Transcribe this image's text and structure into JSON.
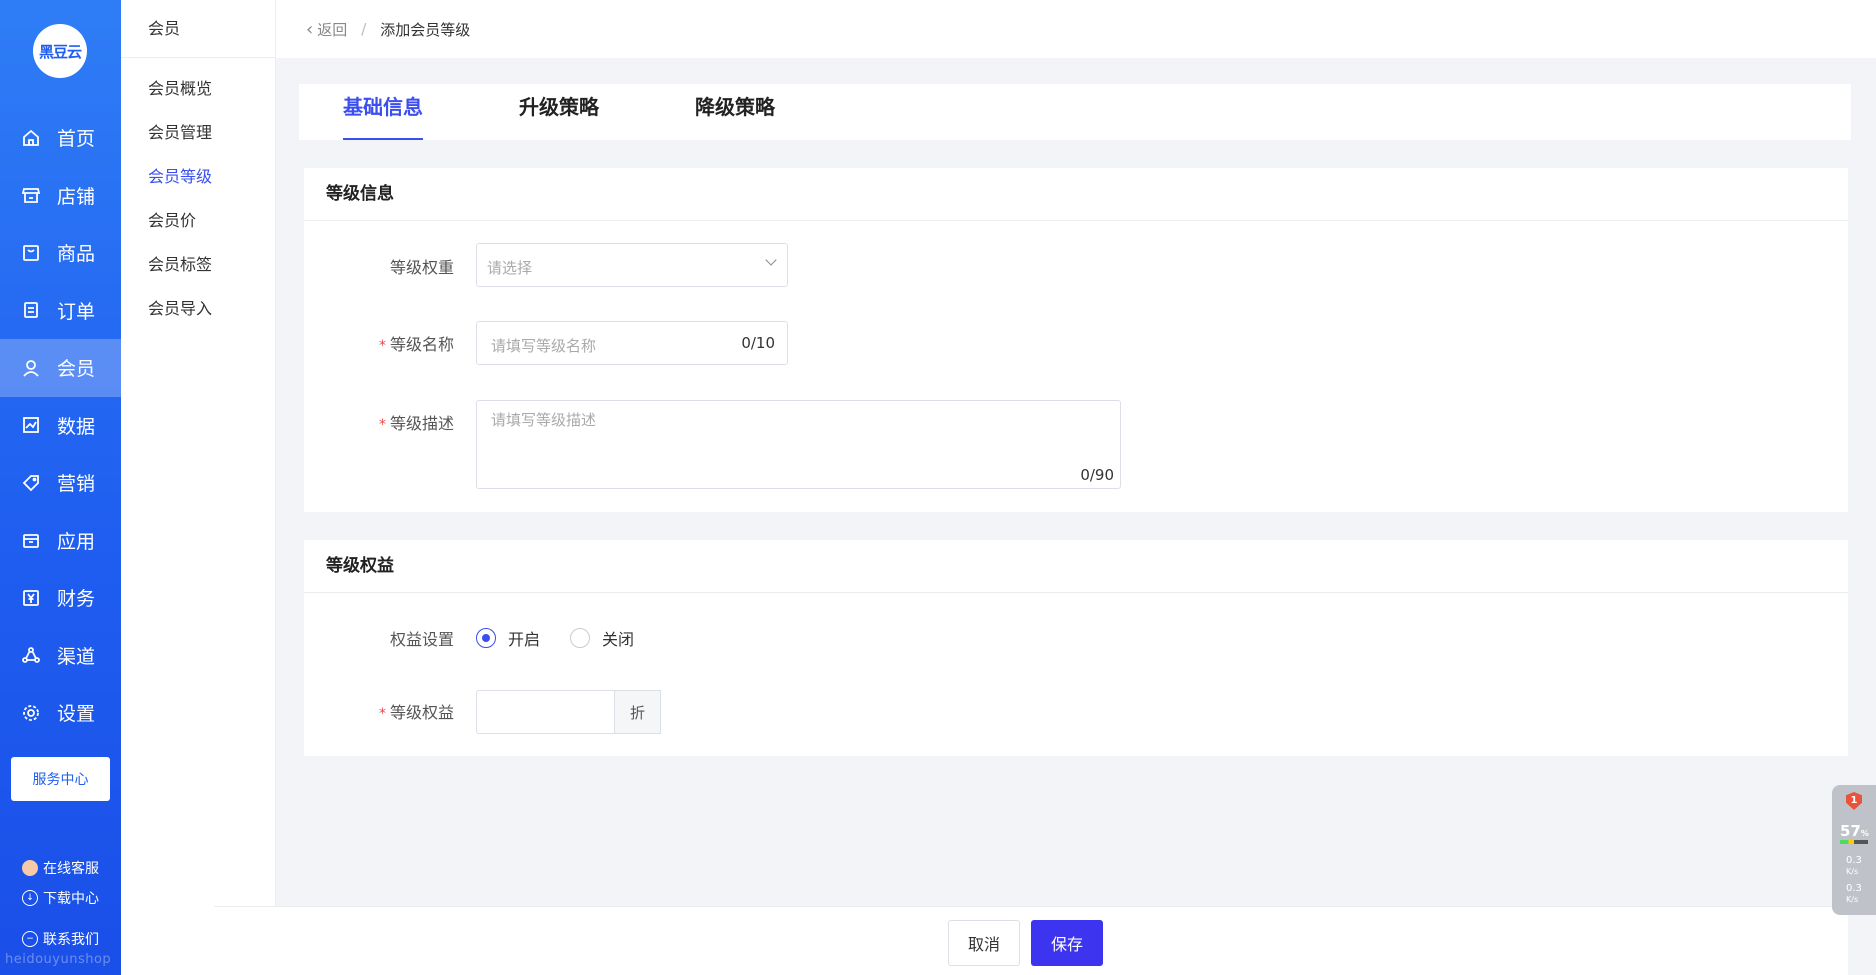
{
  "brand": {
    "logo_text": "黑豆云",
    "watermark": "heidouyunshop"
  },
  "nav": {
    "items": [
      {
        "label": "首页",
        "icon": "home-icon"
      },
      {
        "label": "店铺",
        "icon": "store-icon"
      },
      {
        "label": "商品",
        "icon": "goods-icon"
      },
      {
        "label": "订单",
        "icon": "order-icon"
      },
      {
        "label": "会员",
        "icon": "user-icon"
      },
      {
        "label": "数据",
        "icon": "chart-icon"
      },
      {
        "label": "营销",
        "icon": "tag-icon"
      },
      {
        "label": "应用",
        "icon": "box-icon"
      },
      {
        "label": "财务",
        "icon": "yen-icon"
      },
      {
        "label": "渠道",
        "icon": "channel-icon"
      },
      {
        "label": "设置",
        "icon": "gear-icon"
      }
    ],
    "active": "会员",
    "service_center": "服务中心",
    "online_service": "在线客服",
    "download_center": "下载中心",
    "contact_us": "联系我们"
  },
  "subnav": {
    "title": "会员",
    "items": [
      "会员概览",
      "会员管理",
      "会员等级",
      "会员价",
      "会员标签",
      "会员导入"
    ],
    "active": "会员等级"
  },
  "header": {
    "back_label": "返回",
    "separator": "/",
    "crumb": "添加会员等级"
  },
  "tabs": [
    "基础信息",
    "升级策略",
    "降级策略"
  ],
  "level_info": {
    "title": "等级信息",
    "weight_label": "等级权重",
    "weight_placeholder": "请选择",
    "name_label": "等级名称",
    "name_placeholder": "请填写等级名称",
    "name_counter": "0/10",
    "desc_label": "等级描述",
    "desc_placeholder": "请填写等级描述",
    "desc_counter": "0/90"
  },
  "level_rights": {
    "title": "等级权益",
    "setting_label": "权益设置",
    "option_on": "开启",
    "option_off": "关闭",
    "selected": "开启",
    "rights_label": "等级权益",
    "rights_value": "",
    "suffix": "折"
  },
  "footer": {
    "cancel": "取消",
    "save": "保存"
  },
  "widget": {
    "badge": "1",
    "percent": "57",
    "percent_unit": "%",
    "up": "0.3",
    "down": "0.3",
    "unit": "K/s"
  },
  "colors": {
    "primary": "#3b4ef0",
    "sidebar": "#1f5ef0",
    "required": "#e84a4a"
  }
}
